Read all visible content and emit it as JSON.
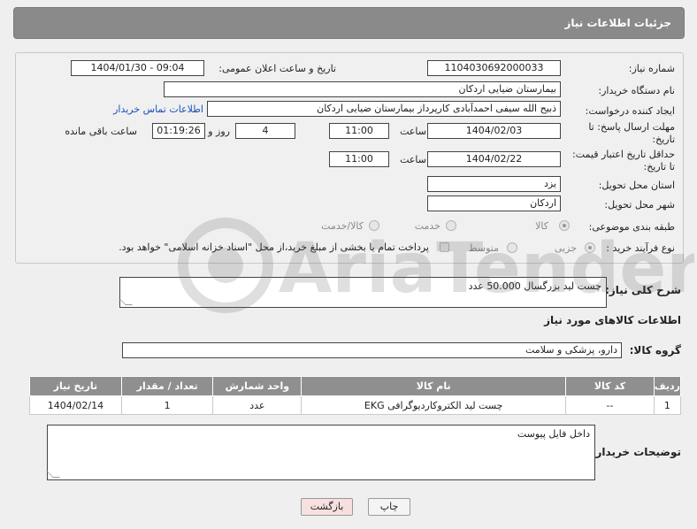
{
  "header": {
    "title": "جزئیات اطلاعات نیاز"
  },
  "form": {
    "need_number_label": "شماره نیاز:",
    "need_number": "1104030692000033",
    "announce_label": "تاریخ و ساعت اعلان عمومی:",
    "announce_value": "1404/01/30 - 09:04",
    "buyer_org_label": "نام دستگاه خریدار:",
    "buyer_org": "بیمارستان ضیایی اردکان",
    "creator_label": "ایجاد کننده درخواست:",
    "creator": "ذبیح الله سیفی احمدآبادی کارپرداز بیمارستان ضیایی اردکان",
    "contact_link": "اطلاعات تماس خریدار",
    "deadline_label_1": "مهلت ارسال پاسخ: تا",
    "deadline_label_2": "تاریخ:",
    "deadline_date": "1404/02/03",
    "time_label": "ساعت",
    "deadline_time": "11:00",
    "days_value": "4",
    "days_label": "روز و",
    "remaining_time": "01:19:26",
    "remaining_label": "ساعت باقی مانده",
    "validity_label_1": "حداقل تاریخ اعتبار قیمت:",
    "validity_label_2": "تا تاریخ:",
    "validity_date": "1404/02/22",
    "validity_time": "11:00",
    "province_label": "استان محل تحویل:",
    "province": "یزد",
    "city_label": "شهر محل تحویل:",
    "city": "اردکان",
    "category_label": "طبقه بندی موضوعی:",
    "category_options": [
      "کالا",
      "خدمت",
      "کالا/خدمت"
    ],
    "process_label": "نوع فرآیند خرید :",
    "process_options": [
      "جزیی",
      "متوسط"
    ],
    "payment_note": "پرداخت تمام یا بخشی از مبلغ خرید،از محل \"اسناد خزانه اسلامی\" خواهد بود."
  },
  "description": {
    "label": "شرح کلی نیاز:",
    "value": "چست لید بزرگسال  50.000 عدد"
  },
  "goods_section": {
    "title": "اطلاعات کالاهای مورد نیاز",
    "group_label": "گروه کالا:",
    "group_value": "دارو، پزشکی و سلامت"
  },
  "table": {
    "headers": [
      "ردیف",
      "کد کالا",
      "نام کالا",
      "واحد شمارش",
      "تعداد / مقدار",
      "تاریخ نیاز"
    ],
    "rows": [
      [
        "1",
        "--",
        "چست لید الکتروکاردیوگرافی EKG",
        "عدد",
        "1",
        "1404/02/14"
      ]
    ]
  },
  "buyer_notes": {
    "label": "توضیحات خریدار:",
    "value": "داخل فایل پیوست"
  },
  "buttons": {
    "print": "چاپ",
    "back": "بازگشت"
  },
  "watermark": {
    "text": "AriaTender.net"
  },
  "colors": {
    "header_bg": "#8a8a8a",
    "link": "#1a4fb8",
    "back_button_bg": "#f8e0e0"
  }
}
